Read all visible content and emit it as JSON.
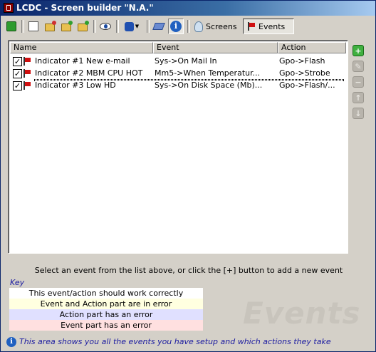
{
  "window": {
    "title": "LCDC - Screen builder \"N.A.\"",
    "close_glyph": "×"
  },
  "toolbar": {
    "icons": [
      "app-green-icon",
      "new-page-icon",
      "open-folder-icon",
      "open-folder-up-icon",
      "save-folder-icon",
      "preview-eye-icon",
      "plugin-icon",
      "eraser-icon",
      "info-icon"
    ],
    "screens_label": "Screens",
    "events_label": "Events"
  },
  "list": {
    "columns": [
      "Name",
      "Event",
      "Action"
    ],
    "rows": [
      {
        "checked": true,
        "name": "Indicator #1 New e-mail",
        "event": "Sys->On Mail In",
        "action": "Gpo->Flash"
      },
      {
        "checked": true,
        "name": "Indicator #2 MBM CPU HOT",
        "event": "Mm5->When Temperatur...",
        "action": "Gpo->Strobe"
      },
      {
        "checked": true,
        "name": "Indicator #3 Low HD",
        "event": "Sys->On Disk Space (Mb)...",
        "action": "Gpo->Flash/..."
      }
    ]
  },
  "side_buttons": [
    "add-icon",
    "edit-icon",
    "remove-icon",
    "move-up-icon",
    "move-down-icon"
  ],
  "hint": "Select an event from the list above, or click the [+] button to add a new event",
  "key": {
    "label": "Key",
    "items": [
      {
        "text": "This event/action should work correctly",
        "color": "#ffffff"
      },
      {
        "text": "Event and Action part are in error",
        "color": "#ffffe0"
      },
      {
        "text": "Action part has an error",
        "color": "#e0e0ff"
      },
      {
        "text": "Event part has an error",
        "color": "#ffe0e0"
      }
    ]
  },
  "watermark": "Events",
  "status": {
    "text": "This area shows you all the events you have setup and which actions they take"
  }
}
